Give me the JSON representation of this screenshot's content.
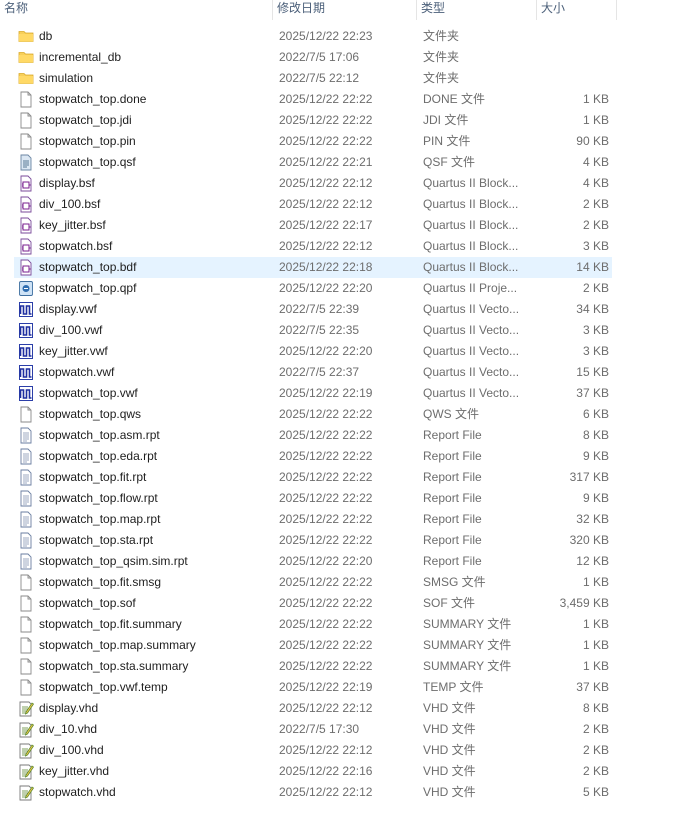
{
  "columns": {
    "name": "名称",
    "modified": "修改日期",
    "type": "类型",
    "size": "大小"
  },
  "colors": {
    "selected_row": "#e5f3ff",
    "folder": "#f7cf5a",
    "header_text": "#4c607a",
    "meta_text": "#6d6d6d"
  },
  "files": [
    {
      "name": "db",
      "modified": "2025/12/22 22:23",
      "type": "文件夹",
      "size": "",
      "icon": "folder-icon"
    },
    {
      "name": "incremental_db",
      "modified": "2022/7/5 17:06",
      "type": "文件夹",
      "size": "",
      "icon": "folder-icon"
    },
    {
      "name": "simulation",
      "modified": "2022/7/5 22:12",
      "type": "文件夹",
      "size": "",
      "icon": "folder-icon"
    },
    {
      "name": "stopwatch_top.done",
      "modified": "2025/12/22 22:22",
      "type": "DONE 文件",
      "size": "1 KB",
      "icon": "blank-file-icon"
    },
    {
      "name": "stopwatch_top.jdi",
      "modified": "2025/12/22 22:22",
      "type": "JDI 文件",
      "size": "1 KB",
      "icon": "blank-file-icon"
    },
    {
      "name": "stopwatch_top.pin",
      "modified": "2025/12/22 22:22",
      "type": "PIN 文件",
      "size": "90 KB",
      "icon": "blank-file-icon"
    },
    {
      "name": "stopwatch_top.qsf",
      "modified": "2025/12/22 22:21",
      "type": "QSF 文件",
      "size": "4 KB",
      "icon": "settings-file-icon"
    },
    {
      "name": "display.bsf",
      "modified": "2025/12/22 22:12",
      "type": "Quartus II Block...",
      "size": "4 KB",
      "icon": "quartus-block-icon"
    },
    {
      "name": "div_100.bsf",
      "modified": "2025/12/22 22:12",
      "type": "Quartus II Block...",
      "size": "2 KB",
      "icon": "quartus-block-icon"
    },
    {
      "name": "key_jitter.bsf",
      "modified": "2025/12/22 22:17",
      "type": "Quartus II Block...",
      "size": "2 KB",
      "icon": "quartus-block-icon"
    },
    {
      "name": "stopwatch.bsf",
      "modified": "2025/12/22 22:12",
      "type": "Quartus II Block...",
      "size": "3 KB",
      "icon": "quartus-block-icon"
    },
    {
      "name": "stopwatch_top.bdf",
      "modified": "2025/12/22 22:18",
      "type": "Quartus II Block...",
      "size": "14 KB",
      "icon": "quartus-block-icon",
      "selected": true
    },
    {
      "name": "stopwatch_top.qpf",
      "modified": "2025/12/22 22:20",
      "type": "Quartus II Proje...",
      "size": "2 KB",
      "icon": "quartus-project-icon"
    },
    {
      "name": "display.vwf",
      "modified": "2022/7/5 22:39",
      "type": "Quartus II Vecto...",
      "size": "34 KB",
      "icon": "waveform-icon"
    },
    {
      "name": "div_100.vwf",
      "modified": "2022/7/5 22:35",
      "type": "Quartus II Vecto...",
      "size": "3 KB",
      "icon": "waveform-icon"
    },
    {
      "name": "key_jitter.vwf",
      "modified": "2025/12/22 22:20",
      "type": "Quartus II Vecto...",
      "size": "3 KB",
      "icon": "waveform-icon"
    },
    {
      "name": "stopwatch.vwf",
      "modified": "2022/7/5 22:37",
      "type": "Quartus II Vecto...",
      "size": "15 KB",
      "icon": "waveform-icon"
    },
    {
      "name": "stopwatch_top.vwf",
      "modified": "2025/12/22 22:19",
      "type": "Quartus II Vecto...",
      "size": "37 KB",
      "icon": "waveform-icon"
    },
    {
      "name": "stopwatch_top.qws",
      "modified": "2025/12/22 22:22",
      "type": "QWS 文件",
      "size": "6 KB",
      "icon": "blank-file-icon"
    },
    {
      "name": "stopwatch_top.asm.rpt",
      "modified": "2025/12/22 22:22",
      "type": "Report File",
      "size": "8 KB",
      "icon": "text-file-icon"
    },
    {
      "name": "stopwatch_top.eda.rpt",
      "modified": "2025/12/22 22:22",
      "type": "Report File",
      "size": "9 KB",
      "icon": "text-file-icon"
    },
    {
      "name": "stopwatch_top.fit.rpt",
      "modified": "2025/12/22 22:22",
      "type": "Report File",
      "size": "317 KB",
      "icon": "text-file-icon"
    },
    {
      "name": "stopwatch_top.flow.rpt",
      "modified": "2025/12/22 22:22",
      "type": "Report File",
      "size": "9 KB",
      "icon": "text-file-icon"
    },
    {
      "name": "stopwatch_top.map.rpt",
      "modified": "2025/12/22 22:22",
      "type": "Report File",
      "size": "32 KB",
      "icon": "text-file-icon"
    },
    {
      "name": "stopwatch_top.sta.rpt",
      "modified": "2025/12/22 22:22",
      "type": "Report File",
      "size": "320 KB",
      "icon": "text-file-icon"
    },
    {
      "name": "stopwatch_top_qsim.sim.rpt",
      "modified": "2025/12/22 22:20",
      "type": "Report File",
      "size": "12 KB",
      "icon": "text-file-icon"
    },
    {
      "name": "stopwatch_top.fit.smsg",
      "modified": "2025/12/22 22:22",
      "type": "SMSG 文件",
      "size": "1 KB",
      "icon": "blank-file-icon"
    },
    {
      "name": "stopwatch_top.sof",
      "modified": "2025/12/22 22:22",
      "type": "SOF 文件",
      "size": "3,459 KB",
      "icon": "blank-file-icon"
    },
    {
      "name": "stopwatch_top.fit.summary",
      "modified": "2025/12/22 22:22",
      "type": "SUMMARY 文件",
      "size": "1 KB",
      "icon": "blank-file-icon"
    },
    {
      "name": "stopwatch_top.map.summary",
      "modified": "2025/12/22 22:22",
      "type": "SUMMARY 文件",
      "size": "1 KB",
      "icon": "blank-file-icon"
    },
    {
      "name": "stopwatch_top.sta.summary",
      "modified": "2025/12/22 22:22",
      "type": "SUMMARY 文件",
      "size": "1 KB",
      "icon": "blank-file-icon"
    },
    {
      "name": "stopwatch_top.vwf.temp",
      "modified": "2025/12/22 22:19",
      "type": "TEMP 文件",
      "size": "37 KB",
      "icon": "blank-file-icon"
    },
    {
      "name": "display.vhd",
      "modified": "2025/12/22 22:12",
      "type": "VHD 文件",
      "size": "8 KB",
      "icon": "vhd-file-icon"
    },
    {
      "name": "div_10.vhd",
      "modified": "2022/7/5 17:30",
      "type": "VHD 文件",
      "size": "2 KB",
      "icon": "vhd-file-icon"
    },
    {
      "name": "div_100.vhd",
      "modified": "2025/12/22 22:12",
      "type": "VHD 文件",
      "size": "2 KB",
      "icon": "vhd-file-icon"
    },
    {
      "name": "key_jitter.vhd",
      "modified": "2025/12/22 22:16",
      "type": "VHD 文件",
      "size": "2 KB",
      "icon": "vhd-file-icon"
    },
    {
      "name": "stopwatch.vhd",
      "modified": "2025/12/22 22:12",
      "type": "VHD 文件",
      "size": "5 KB",
      "icon": "vhd-file-icon"
    }
  ]
}
